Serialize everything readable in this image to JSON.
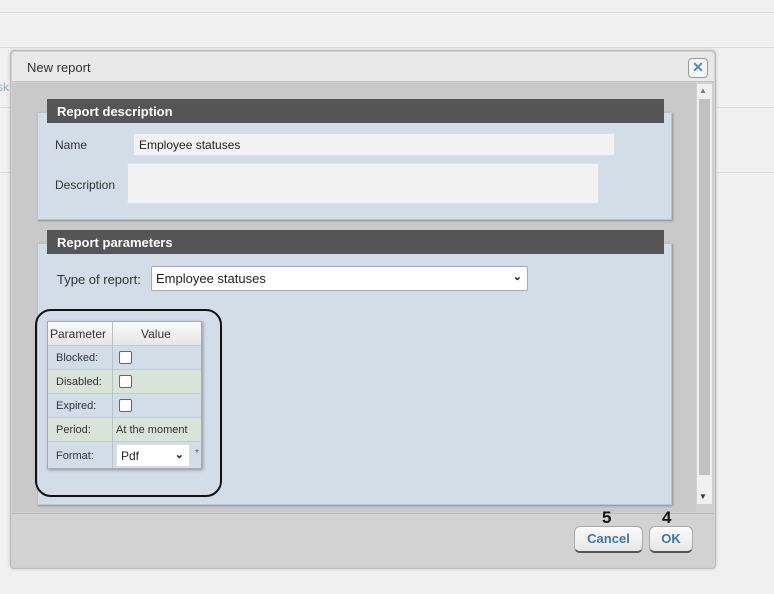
{
  "background": {
    "clipped_text": "sk"
  },
  "dialog": {
    "title": "New report",
    "close_icon": "close-icon",
    "report_description": {
      "header": "Report description",
      "name_label": "Name",
      "name_value": "Employee statuses",
      "description_label": "Description",
      "description_value": ""
    },
    "report_parameters": {
      "header": "Report parameters",
      "type_label": "Type of report:",
      "type_value": "Employee statuses",
      "table": {
        "headers": [
          "Parameter",
          "Value"
        ],
        "rows": [
          {
            "param": "Blocked:",
            "type": "checkbox",
            "checked": false
          },
          {
            "param": "Disabled:",
            "type": "checkbox",
            "checked": false
          },
          {
            "param": "Expired:",
            "type": "checkbox",
            "checked": false
          },
          {
            "param": "Period:",
            "type": "text",
            "value": "At the moment"
          },
          {
            "param": "Format:",
            "type": "select",
            "value": "Pdf",
            "required_mark": "*"
          }
        ]
      }
    },
    "footer": {
      "cancel_label": "Cancel",
      "ok_label": "OK",
      "cancel_annotation": "5",
      "ok_annotation": "4"
    }
  },
  "colors": {
    "header_bg": "#555555",
    "panel_bg": "#d3dde8",
    "alt_row": "#d8e4d8",
    "button_text": "#3a78b0"
  }
}
